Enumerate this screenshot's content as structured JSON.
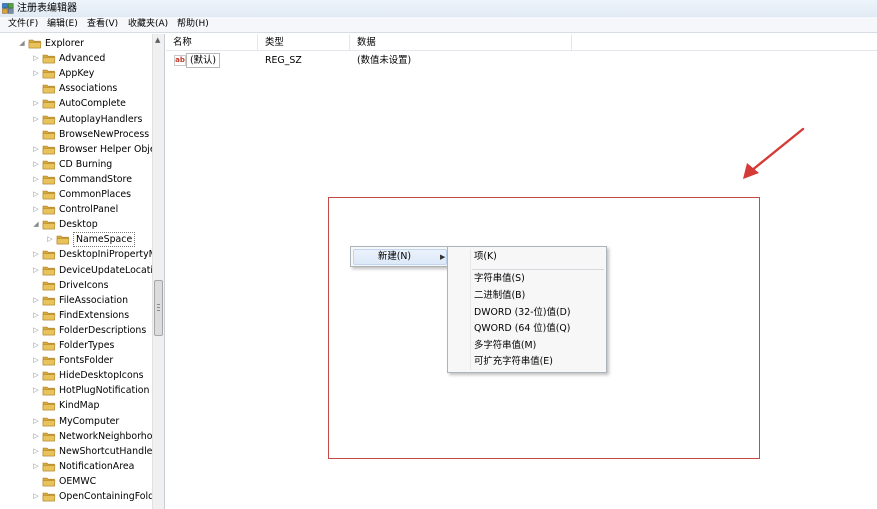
{
  "window": {
    "title": "注册表编辑器"
  },
  "menu": [
    "文件(F)",
    "编辑(E)",
    "查看(V)",
    "收藏夹(A)",
    "帮助(H)"
  ],
  "tree": {
    "items": [
      {
        "label": "Explorer",
        "level": 0,
        "state": "expanded"
      },
      {
        "label": "Advanced",
        "level": 1,
        "state": "collapsed"
      },
      {
        "label": "AppKey",
        "level": 1,
        "state": "collapsed"
      },
      {
        "label": "Associations",
        "level": 1,
        "state": "none"
      },
      {
        "label": "AutoComplete",
        "level": 1,
        "state": "collapsed"
      },
      {
        "label": "AutoplayHandlers",
        "level": 1,
        "state": "collapsed"
      },
      {
        "label": "BrowseNewProcess",
        "level": 1,
        "state": "none"
      },
      {
        "label": "Browser Helper Obje",
        "level": 1,
        "state": "collapsed"
      },
      {
        "label": "CD Burning",
        "level": 1,
        "state": "collapsed"
      },
      {
        "label": "CommandStore",
        "level": 1,
        "state": "collapsed"
      },
      {
        "label": "CommonPlaces",
        "level": 1,
        "state": "collapsed"
      },
      {
        "label": "ControlPanel",
        "level": 1,
        "state": "collapsed"
      },
      {
        "label": "Desktop",
        "level": 1,
        "state": "expanded"
      },
      {
        "label": "NameSpace",
        "level": 2,
        "state": "collapsed",
        "selected": true
      },
      {
        "label": "DesktopIniPropertyM",
        "level": 1,
        "state": "collapsed"
      },
      {
        "label": "DeviceUpdateLocatic",
        "level": 1,
        "state": "collapsed"
      },
      {
        "label": "DriveIcons",
        "level": 1,
        "state": "none"
      },
      {
        "label": "FileAssociation",
        "level": 1,
        "state": "collapsed"
      },
      {
        "label": "FindExtensions",
        "level": 1,
        "state": "collapsed"
      },
      {
        "label": "FolderDescriptions",
        "level": 1,
        "state": "collapsed"
      },
      {
        "label": "FolderTypes",
        "level": 1,
        "state": "collapsed"
      },
      {
        "label": "FontsFolder",
        "level": 1,
        "state": "collapsed"
      },
      {
        "label": "HideDesktopIcons",
        "level": 1,
        "state": "collapsed"
      },
      {
        "label": "HotPlugNotification",
        "level": 1,
        "state": "collapsed"
      },
      {
        "label": "KindMap",
        "level": 1,
        "state": "none"
      },
      {
        "label": "MyComputer",
        "level": 1,
        "state": "collapsed"
      },
      {
        "label": "NetworkNeighborho",
        "level": 1,
        "state": "collapsed"
      },
      {
        "label": "NewShortcutHandler",
        "level": 1,
        "state": "collapsed"
      },
      {
        "label": "NotificationArea",
        "level": 1,
        "state": "collapsed"
      },
      {
        "label": "OEMWC",
        "level": 1,
        "state": "none"
      },
      {
        "label": "OpenContainingFold",
        "level": 1,
        "state": "collapsed"
      }
    ]
  },
  "list": {
    "columns": [
      "名称",
      "类型",
      "数据"
    ],
    "rows": [
      {
        "icon": "ab",
        "name": "(默认)",
        "type": "REG_SZ",
        "data": "(数值未设置)"
      }
    ]
  },
  "context_menu": {
    "new_label": "新建(N)",
    "submenu": [
      "项(K)",
      "字符串值(S)",
      "二进制值(B)",
      "DWORD (32-位)值(D)",
      "QWORD (64 位)值(Q)",
      "多字符串值(M)",
      "可扩充字符串值(E)"
    ]
  },
  "colors": {
    "annotation": "#c44a4a",
    "folder": "#e8c25a",
    "menu_highlight": "#dde9f8"
  }
}
